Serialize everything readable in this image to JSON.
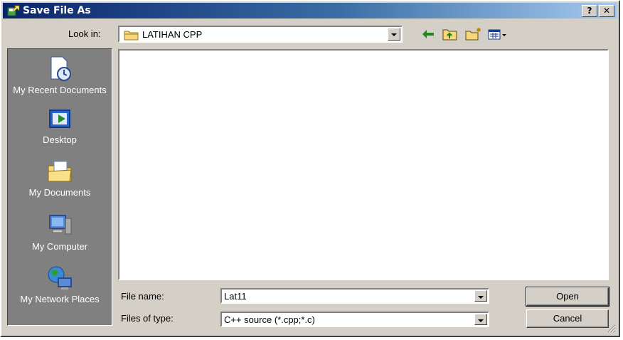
{
  "window": {
    "title": "Save File As",
    "help_label": "?",
    "close_label": "✕"
  },
  "lookin": {
    "label": "Look in:",
    "value": "LATIHAN CPP"
  },
  "toolbar": {
    "back": "back-icon",
    "up": "up-folder-icon",
    "new_folder": "new-folder-icon",
    "view": "view-menu-icon"
  },
  "places": [
    {
      "label": "My Recent Documents",
      "icon": "recent-documents-icon"
    },
    {
      "label": "Desktop",
      "icon": "desktop-icon"
    },
    {
      "label": "My Documents",
      "icon": "my-documents-icon"
    },
    {
      "label": "My Computer",
      "icon": "my-computer-icon"
    },
    {
      "label": "My Network Places",
      "icon": "network-places-icon"
    }
  ],
  "filename": {
    "label": "File name:",
    "value": "Lat11"
  },
  "filetype": {
    "label": "Files of type:",
    "value": "C++ source (*.cpp;*.c)"
  },
  "buttons": {
    "open": "Open",
    "cancel": "Cancel"
  },
  "colors": {
    "title_start": "#0a246a",
    "title_end": "#a6caf0",
    "face": "#d4d0c8",
    "places_bg": "#808080"
  }
}
